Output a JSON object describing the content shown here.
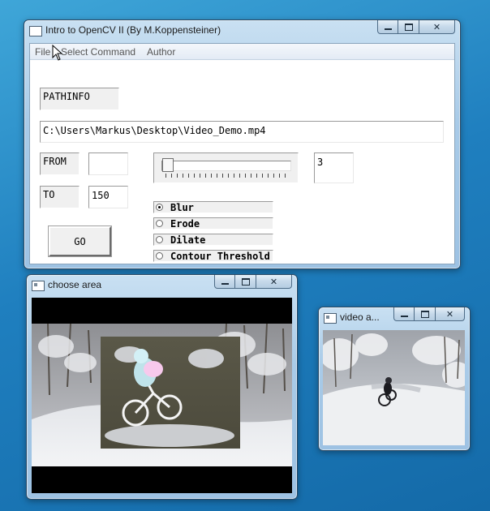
{
  "main_window": {
    "title": "Intro to OpenCV II (By M.Koppensteiner)",
    "controls": {
      "minimize": "minimize-icon",
      "maximize": "maximize-icon",
      "close": "✕"
    },
    "menu": [
      "File",
      "Select Command",
      "Author"
    ],
    "pathinfo_label": "PATHINFO",
    "path_value": "C:\\Users\\Markus\\Desktop\\Video_Demo.mp4",
    "from_label": "FROM",
    "from_value": "",
    "to_label": "TO",
    "to_value": "150",
    "slider": {
      "value": 0,
      "display_value": "3"
    },
    "go_button": "GO",
    "commands": [
      {
        "label": "Blur",
        "selected": true
      },
      {
        "label": "Erode",
        "selected": false
      },
      {
        "label": "Dilate",
        "selected": false
      },
      {
        "label": "Contour Threshold",
        "selected": false
      }
    ]
  },
  "area_window": {
    "title": "choose area",
    "controls": {
      "minimize": "minimize-icon",
      "maximize": "maximize-icon",
      "close": "✕"
    }
  },
  "video_window": {
    "title": "video a...",
    "controls": {
      "minimize": "minimize-icon",
      "maximize": "maximize-icon",
      "close": "✕"
    }
  },
  "colors": {
    "desktop": "#1f7fbf",
    "frame": "#a9cbe8",
    "menu_text": "#555555"
  }
}
